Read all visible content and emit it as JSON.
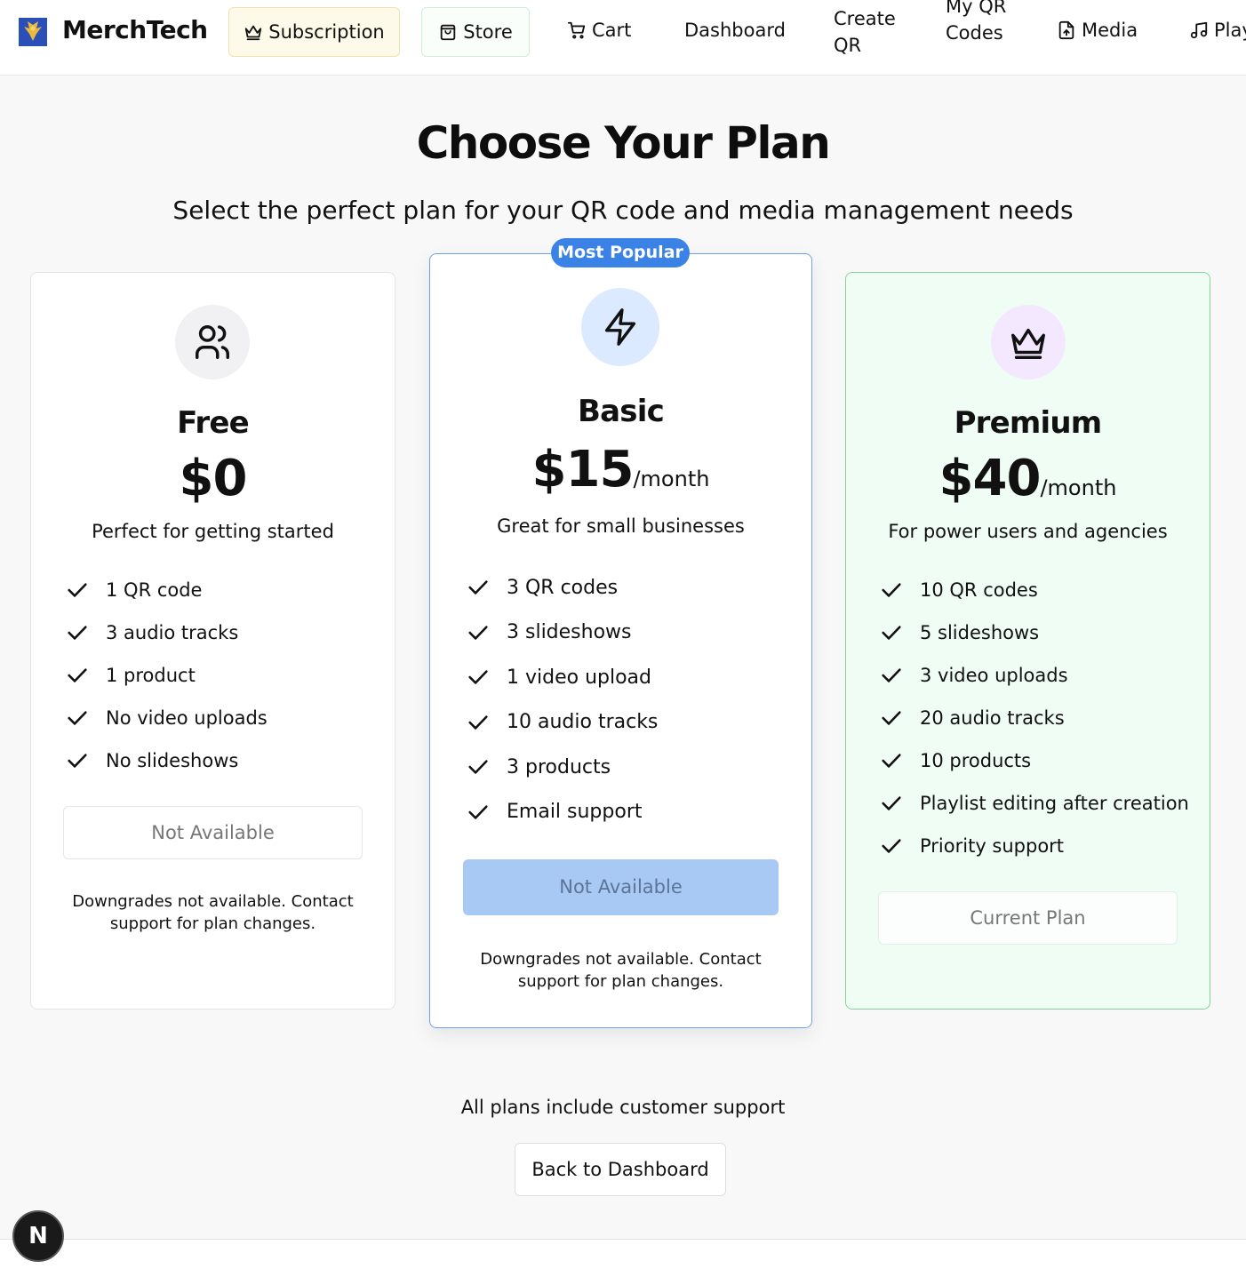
{
  "header": {
    "brand": "MerchTech",
    "nav": {
      "subscription": "Subscription",
      "store": "Store",
      "cart": "Cart",
      "dashboard": "Dashboard",
      "create_qr": "Create QR",
      "my_qr_codes": "My QR Codes",
      "media": "Media",
      "playlists": "Playlists"
    }
  },
  "page": {
    "title": "Choose Your Plan",
    "subtitle": "Select the perfect plan for your QR code and media management needs"
  },
  "plans": {
    "free": {
      "name": "Free",
      "price": "$0",
      "description": "Perfect for getting started",
      "features": [
        "1 QR code",
        "3 audio tracks",
        "1 product",
        "No video uploads",
        "No slideshows"
      ],
      "button": "Not Available",
      "note": "Downgrades not available. Contact support for plan changes."
    },
    "basic": {
      "badge": "Most Popular",
      "name": "Basic",
      "price": "$15",
      "period": "/month",
      "description": "Great for small businesses",
      "features": [
        "3 QR codes",
        "3 slideshows",
        "1 video upload",
        "10 audio tracks",
        "3 products",
        "Email support"
      ],
      "button": "Not Available",
      "note": "Downgrades not available. Contact support for plan changes."
    },
    "premium": {
      "name": "Premium",
      "price": "$40",
      "period": "/month",
      "description": "For power users and agencies",
      "features": [
        "10 QR codes",
        "5 slideshows",
        "3 video uploads",
        "20 audio tracks",
        "10 products",
        "Playlist editing after creation",
        "Priority support"
      ],
      "button": "Current Plan"
    }
  },
  "footer": {
    "note": "All plans include customer support",
    "back_button": "Back to Dashboard"
  },
  "dev_badge": "N",
  "colors": {
    "accent_blue": "#3b82e6",
    "subscription_bg": "#fefaea",
    "premium_bg": "#f0fdf4",
    "premium_border": "#86d39a"
  }
}
